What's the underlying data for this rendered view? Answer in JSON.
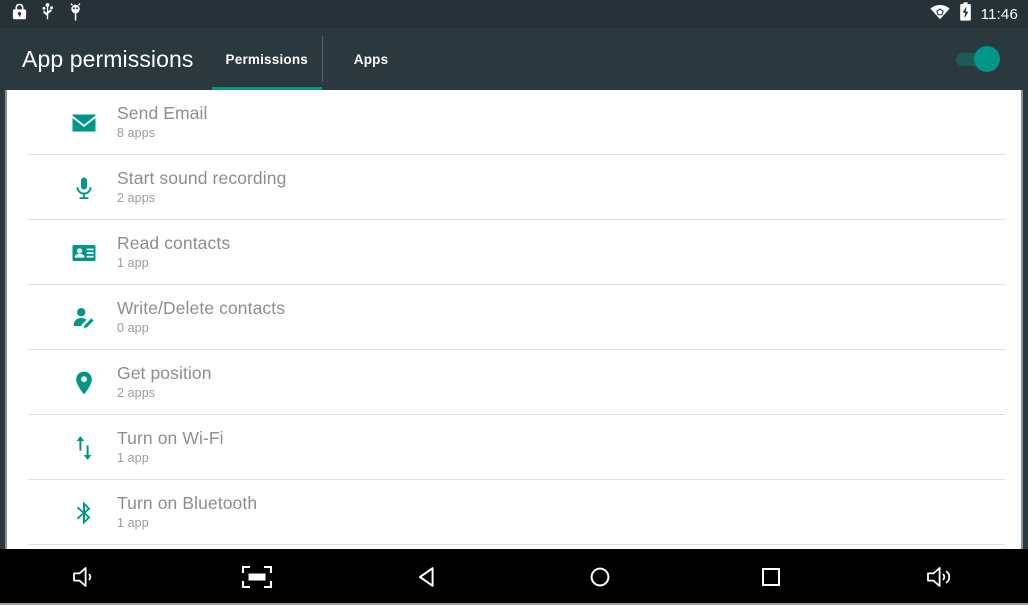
{
  "status_bar": {
    "icons": [
      "lock-icon",
      "usb-icon",
      "debug-icon"
    ],
    "right_icons": [
      "wifi-icon",
      "battery-charging-icon"
    ],
    "clock": "11:46"
  },
  "app_bar": {
    "title": "App permissions",
    "tabs": [
      {
        "label": "Permissions",
        "active": true
      },
      {
        "label": "Apps",
        "active": false
      }
    ],
    "toggle": {
      "name": "master-toggle",
      "state": "on"
    }
  },
  "colors": {
    "accent": "#009688",
    "app_bar": "#2b383d",
    "status_bar": "#263238",
    "title_text": "#8e8e8e",
    "sub_text": "#9b9b9b",
    "divider": "#e0e0e0",
    "nav_bar": "#000000"
  },
  "permissions": [
    {
      "icon": "email-icon",
      "title": "Send Email",
      "count": "8 apps"
    },
    {
      "icon": "microphone-icon",
      "title": "Start sound recording",
      "count": "2 apps"
    },
    {
      "icon": "contact-card-icon",
      "title": "Read contacts",
      "count": "1 app"
    },
    {
      "icon": "person-edit-icon",
      "title": "Write/Delete contacts",
      "count": "0 app"
    },
    {
      "icon": "location-pin-icon",
      "title": "Get position",
      "count": "2 apps"
    },
    {
      "icon": "data-transfer-icon",
      "title": "Turn on Wi-Fi",
      "count": "1 app"
    },
    {
      "icon": "bluetooth-icon",
      "title": "Turn on Bluetooth",
      "count": "1 app"
    }
  ],
  "nav_bar": {
    "buttons": [
      "volume-down-icon",
      "screenshot-icon",
      "back-icon",
      "home-icon",
      "recents-icon",
      "volume-up-icon"
    ]
  }
}
